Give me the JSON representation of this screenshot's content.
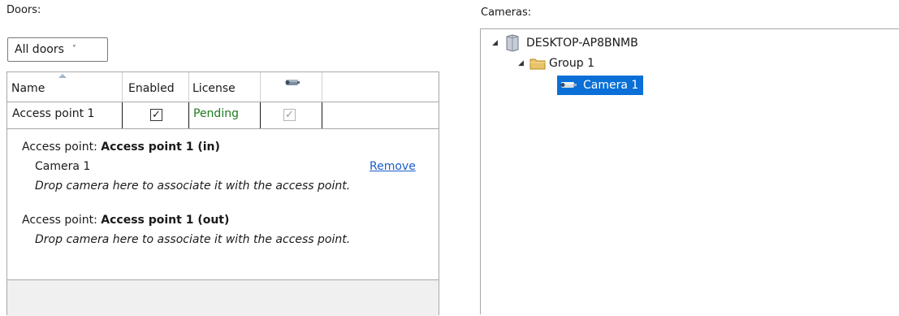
{
  "doors": {
    "label": "Doors:",
    "filter": {
      "selected": "All doors"
    },
    "columns": {
      "name": "Name",
      "enabled": "Enabled",
      "license": "License",
      "camera_icon": "camera-icon"
    },
    "rows": [
      {
        "name": "Access point 1",
        "enabled": true,
        "license": "Pending",
        "camera": true
      }
    ],
    "details": {
      "ap_in": {
        "prefix": "Access point:",
        "title": "Access point 1 (in)",
        "camera": "Camera 1",
        "remove": "Remove",
        "hint": "Drop camera here to associate it with the access point."
      },
      "ap_out": {
        "prefix": "Access point:",
        "title": "Access point 1 (out)",
        "hint": "Drop camera here to associate it with the access point."
      }
    }
  },
  "cameras": {
    "label": "Cameras:",
    "tree": {
      "server": "DESKTOP-AP8BNMB",
      "group": "Group 1",
      "camera": "Camera 1"
    }
  },
  "colors": {
    "selection": "#0a6fd6",
    "license_pending": "#1e7a1e",
    "link": "#1a5fc8"
  }
}
